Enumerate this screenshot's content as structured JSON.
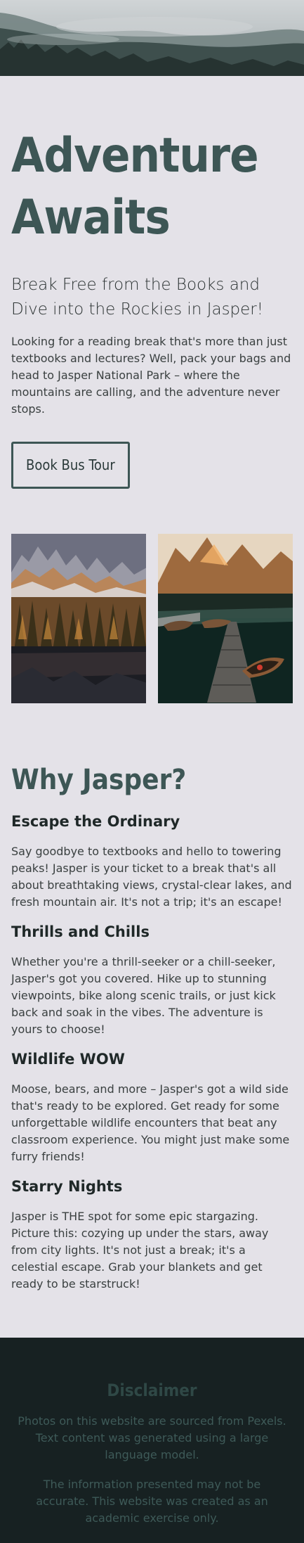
{
  "hero": {
    "image": "misty-mountain-forest"
  },
  "main": {
    "title_line1": "Adventure",
    "title_line2": "Awaits",
    "subtitle": "Break Free from the Books and Dive into the Rockies in Jasper!",
    "intro": "Looking for a reading break that's more than just textbooks and lectures? Well, pack your bags and head to Jasper National Park – where the mountains are calling, and the adventure never stops.",
    "cta_label": "Book Bus Tour"
  },
  "gallery": [
    {
      "image": "mountain-lake-forest"
    },
    {
      "image": "lake-boats-dock"
    }
  ],
  "why": {
    "title": "Why Jasper?",
    "sections": [
      {
        "heading": "Escape the Ordinary",
        "text": "Say goodbye to textbooks and hello to towering peaks! Jasper is your ticket to a break that's all about breathtaking views, crystal-clear lakes, and fresh mountain air. It's not a trip; it's an escape!"
      },
      {
        "heading": "Thrills and Chills",
        "text": "Whether you're a thrill-seeker or a chill-seeker, Jasper's got you covered. Hike up to stunning viewpoints, bike along scenic trails, or just kick back and soak in the vibes. The adventure is yours to choose!"
      },
      {
        "heading": "Wildlife WOW",
        "text": "Moose, bears, and more – Jasper's got a wild side that's ready to be explored. Get ready for some unforgettable wildlife encounters that beat any classroom experience. You might just make some furry friends!"
      },
      {
        "heading": "Starry Nights",
        "text": "Jasper is THE spot for some epic stargazing. Picture this: cozying up under the stars, away from city lights. It's not just a break; it's a celestial escape. Grab your blankets and get ready to be starstruck!"
      }
    ]
  },
  "footer": {
    "title": "Disclaimer",
    "p1": "Photos on this website are sourced from Pexels. Text content was generated using a large language model.",
    "p2": "The information presented may not be accurate. This website was created as an academic exercise only."
  }
}
